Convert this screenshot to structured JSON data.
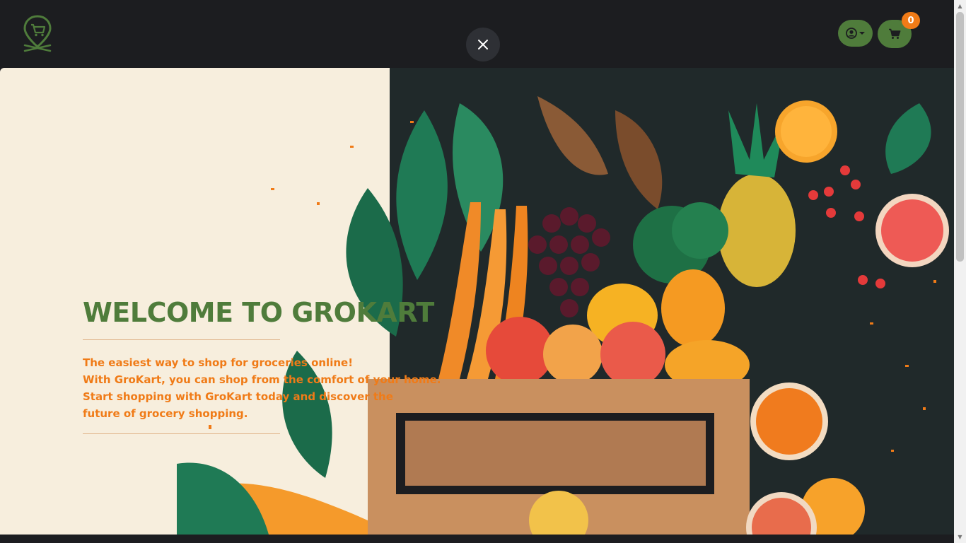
{
  "app": {
    "brand": "GroKart",
    "logo_icon": "cart-location-pin-icon",
    "brand_color": "#4f7c3b",
    "accent_color": "#f07b17"
  },
  "header": {
    "close_icon": "close-icon",
    "user_icon": "user-circle-icon",
    "user_dropdown_icon": "caret-down-icon",
    "cart_icon": "shopping-cart-icon",
    "cart_count": "0"
  },
  "hero": {
    "title": "WELCOME TO GROKART",
    "lines": [
      "The easiest way to shop for groceries online!",
      "With GroKart, you can shop from the comfort of your home.",
      "Start shopping with GroKart today and discover the",
      "future of grocery shopping."
    ]
  }
}
